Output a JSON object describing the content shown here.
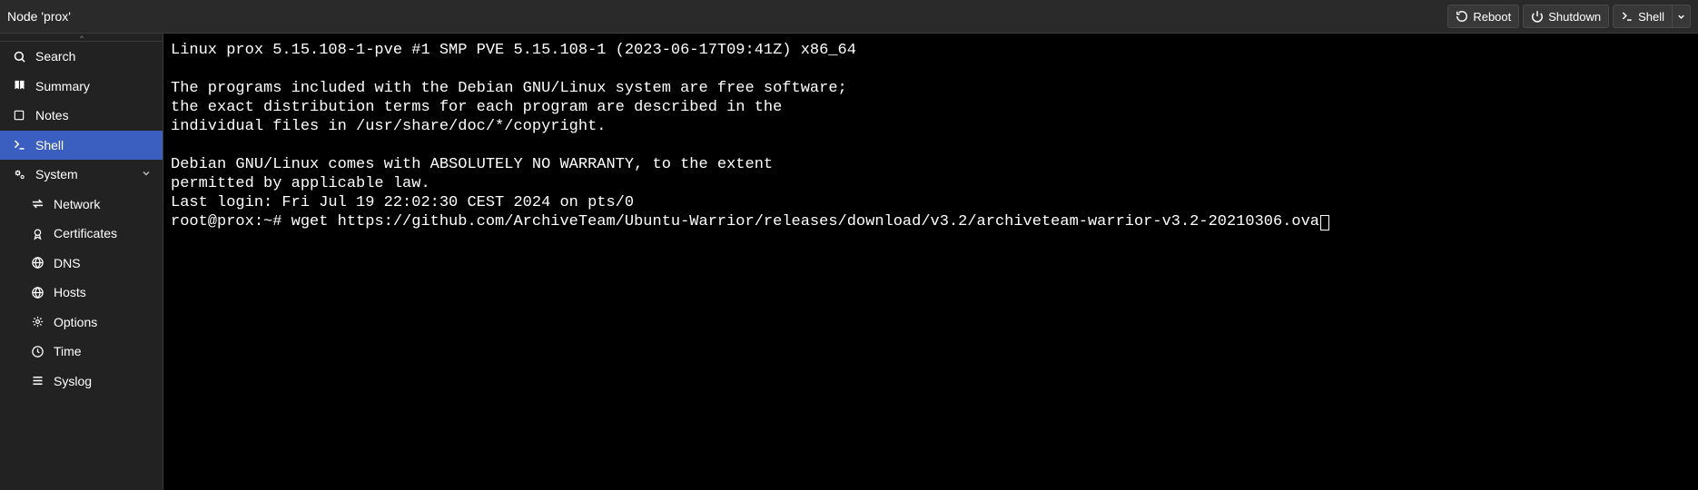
{
  "header": {
    "title": "Node 'prox'",
    "reboot": "Reboot",
    "shutdown": "Shutdown",
    "shell": "Shell"
  },
  "sidebar": {
    "items": [
      {
        "icon": "search",
        "label": "Search"
      },
      {
        "icon": "book",
        "label": "Summary"
      },
      {
        "icon": "sticky-note",
        "label": "Notes"
      },
      {
        "icon": "terminal",
        "label": "Shell",
        "active": true
      },
      {
        "icon": "cogs",
        "label": "System",
        "expandable": true,
        "expanded": true
      },
      {
        "icon": "exchange",
        "label": "Network",
        "sub": true
      },
      {
        "icon": "certificate",
        "label": "Certificates",
        "sub": true
      },
      {
        "icon": "globe",
        "label": "DNS",
        "sub": true
      },
      {
        "icon": "globe",
        "label": "Hosts",
        "sub": true
      },
      {
        "icon": "cog",
        "label": "Options",
        "sub": true
      },
      {
        "icon": "clock",
        "label": "Time",
        "sub": true
      },
      {
        "icon": "list",
        "label": "Syslog",
        "sub": true
      }
    ]
  },
  "terminal": {
    "lines": [
      "Linux prox 5.15.108-1-pve #1 SMP PVE 5.15.108-1 (2023-06-17T09:41Z) x86_64",
      "",
      "The programs included with the Debian GNU/Linux system are free software;",
      "the exact distribution terms for each program are described in the",
      "individual files in /usr/share/doc/*/copyright.",
      "",
      "Debian GNU/Linux comes with ABSOLUTELY NO WARRANTY, to the extent",
      "permitted by applicable law.",
      "Last login: Fri Jul 19 22:02:30 CEST 2024 on pts/0"
    ],
    "prompt": "root@prox:~# ",
    "command": "wget https://github.com/ArchiveTeam/Ubuntu-Warrior/releases/download/v3.2/archiveteam-warrior-v3.2-20210306.ova"
  }
}
